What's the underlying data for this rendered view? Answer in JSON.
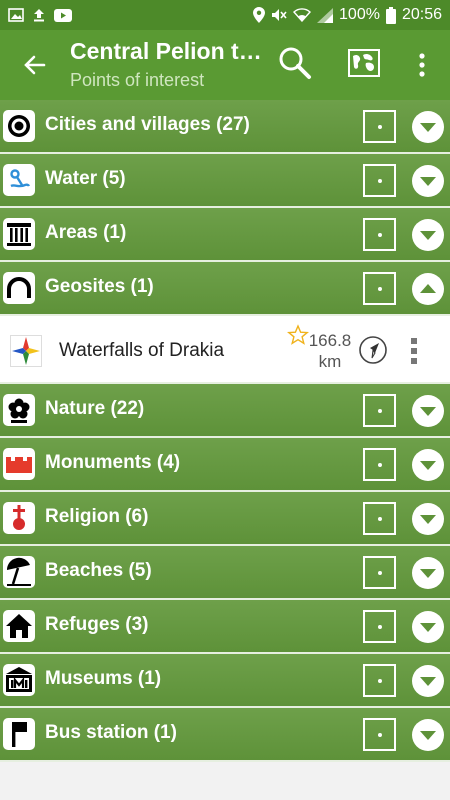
{
  "status_bar": {
    "battery": "100%",
    "time": "20:56",
    "icons": [
      "gallery-icon",
      "upload-icon",
      "youtube-icon",
      "location-icon",
      "mute-icon",
      "wifi-icon",
      "signal-icon",
      "battery-icon"
    ]
  },
  "app_bar": {
    "title": "Central Pelion t…",
    "subtitle": "Points of interest",
    "icons": [
      "back-arrow-icon",
      "search-icon",
      "map-icon",
      "more-vert-icon"
    ]
  },
  "categories": [
    {
      "label": "Cities and villages (27)",
      "icon": "target-icon",
      "expanded": false
    },
    {
      "label": "Water (5)",
      "icon": "water-icon",
      "expanded": false
    },
    {
      "label": "Areas (1)",
      "icon": "column-icon",
      "expanded": false
    },
    {
      "label": "Geosites (1)",
      "icon": "arch-icon",
      "expanded": true
    },
    {
      "label": "Nature (22)",
      "icon": "flower-icon",
      "expanded": false
    },
    {
      "label": "Monuments (4)",
      "icon": "castle-icon",
      "expanded": false
    },
    {
      "label": "Religion (6)",
      "icon": "cross-icon",
      "expanded": false
    },
    {
      "label": "Beaches (5)",
      "icon": "umbrella-icon",
      "expanded": false
    },
    {
      "label": "Refuges (3)",
      "icon": "house-icon",
      "expanded": false
    },
    {
      "label": "Museums (1)",
      "icon": "museum-icon",
      "expanded": false
    },
    {
      "label": "Bus station (1)",
      "icon": "flag-icon",
      "expanded": false
    }
  ],
  "geosite_items": [
    {
      "name": "Waterfalls of Drakia",
      "distance_value": "166.8",
      "distance_unit": "km",
      "icon": "compass-star-icon"
    }
  ],
  "colors": {
    "primary": "#5a9a33",
    "status_bar": "#4d8a29",
    "row": "#6ea04a"
  }
}
